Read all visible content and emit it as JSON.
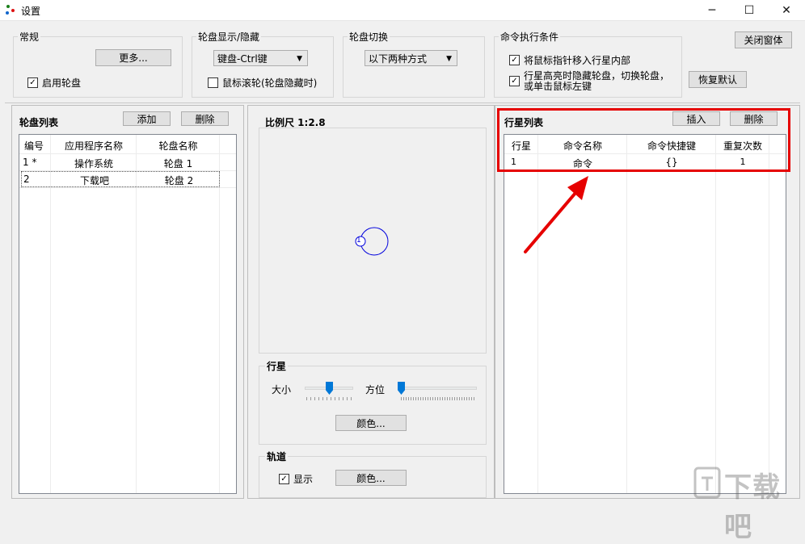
{
  "window": {
    "title": "设置"
  },
  "general": {
    "title": "常规",
    "more_label": "更多...",
    "enable_wheel_label": "启用轮盘",
    "enable_wheel_checked": true
  },
  "show_hide": {
    "title": "轮盘显示/隐藏",
    "select_value": "键盘-Ctrl键",
    "scroll_label": "鼠标滚轮(轮盘隐藏时)",
    "scroll_checked": false
  },
  "switch": {
    "title": "轮盘切换",
    "select_value": "以下两种方式"
  },
  "conditions": {
    "title": "命令执行条件",
    "opt1_label": "将鼠标指针移入行星内部",
    "opt1_checked": true,
    "opt2_line1": "行星高亮时隐藏轮盘，切换轮盘，",
    "opt2_line2": "或单击鼠标左键",
    "opt2_checked": true
  },
  "close_label": "关闭窗体",
  "restore_label": "恢复默认",
  "wheel_list": {
    "title": "轮盘列表",
    "add_label": "添加",
    "delete_label": "删除",
    "columns": [
      "编号",
      "应用程序名称",
      "轮盘名称"
    ],
    "rows": [
      {
        "id": "1 *",
        "app": "操作系统",
        "wheel": "轮盘 1"
      },
      {
        "id": "2",
        "app": "下载吧",
        "wheel": "轮盘 2"
      }
    ]
  },
  "scale": {
    "label": "比例尺 1:2.8",
    "planet_number": "1"
  },
  "planet": {
    "title": "行星",
    "size_label": "大小",
    "size_value": 0.5,
    "direction_label": "方位",
    "direction_value": 0.0,
    "color_label": "颜色..."
  },
  "orbit": {
    "title": "轨道",
    "show_label": "显示",
    "show_checked": true,
    "color_label": "颜色..."
  },
  "planet_list": {
    "title": "行星列表",
    "insert_label": "插入",
    "delete_label": "删除",
    "columns": [
      "行星",
      "命令名称",
      "命令快捷键",
      "重复次数"
    ],
    "rows": [
      {
        "planet": "1",
        "name": "命令",
        "shortcut": "{}",
        "repeat": "1"
      }
    ]
  },
  "watermark": {
    "text": "下载吧"
  },
  "colors": {
    "highlight": "#e60000",
    "accent": "#0078d7"
  }
}
